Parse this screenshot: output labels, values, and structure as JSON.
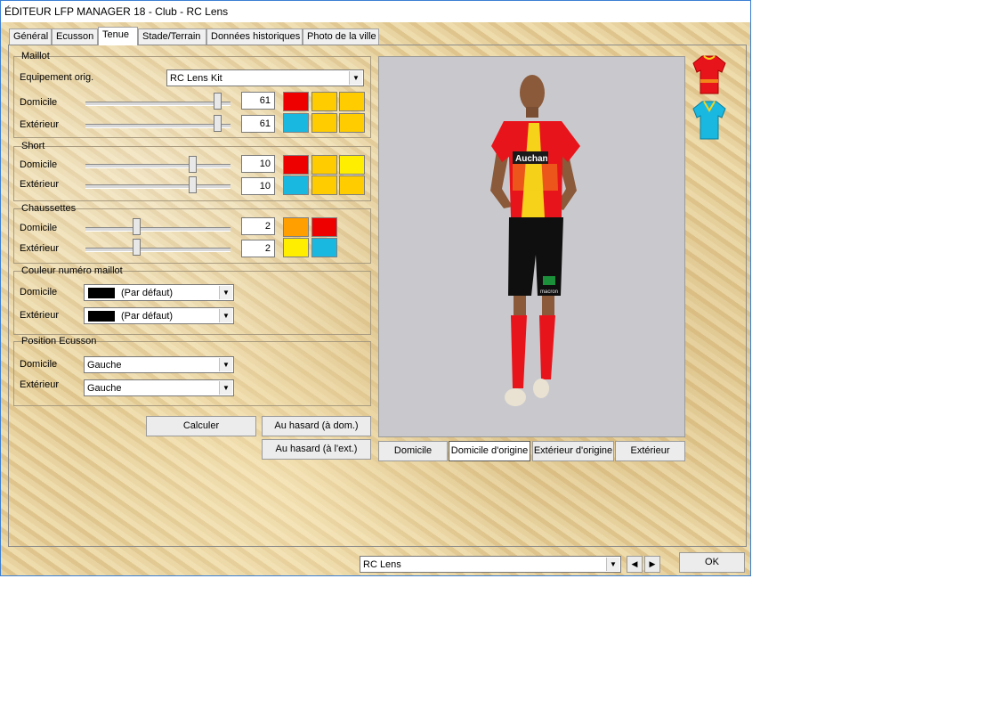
{
  "window": {
    "title": "ÉDITEUR LFP MANAGER 18 - Club - RC Lens"
  },
  "tabs": [
    {
      "label": "Général"
    },
    {
      "label": "Ecusson"
    },
    {
      "label": "Tenue"
    },
    {
      "label": "Stade/Terrain"
    },
    {
      "label": "Données historiques"
    },
    {
      "label": "Photo de la ville"
    }
  ],
  "maillot": {
    "title": "Maillot",
    "orig_label": "Equipement orig.",
    "orig_value": "RC Lens Kit",
    "home_label": "Domicile",
    "home_value": "61",
    "away_label": "Extérieur",
    "away_value": "61",
    "home_colors": [
      "#ee0000",
      "#ffcc00",
      "#ffcc00"
    ],
    "away_colors": [
      "#19b8e0",
      "#ffcc00",
      "#ffcc00"
    ]
  },
  "short": {
    "title": "Short",
    "home_label": "Domicile",
    "home_value": "10",
    "away_label": "Extérieur",
    "away_value": "10",
    "home_colors": [
      "#ee0000",
      "#ffcc00",
      "#ffee00"
    ],
    "away_colors": [
      "#19b8e0",
      "#ffcc00",
      "#ffcc00"
    ]
  },
  "chaussettes": {
    "title": "Chaussettes",
    "home_label": "Domicile",
    "home_value": "2",
    "away_label": "Extérieur",
    "away_value": "2",
    "home_colors": [
      "#ffa000",
      "#ee0000"
    ],
    "away_colors": [
      "#ffee00",
      "#19b8e0"
    ]
  },
  "numero": {
    "title": "Couleur numéro maillot",
    "home_label": "Domicile",
    "home_value": "(Par défaut)",
    "away_label": "Extérieur",
    "away_value": "(Par défaut)"
  },
  "ecusson_pos": {
    "title": "Position Ecusson",
    "home_label": "Domicile",
    "home_value": "Gauche",
    "away_label": "Extérieur",
    "away_value": "Gauche"
  },
  "buttons": {
    "calculer": "Calculer",
    "hasard_dom": "Au hasard (à dom.)",
    "hasard_ext": "Au hasard (à l'ext.)"
  },
  "preview_buttons": {
    "domicile": "Domicile",
    "domicile_origine": "Domicile d'origine",
    "exterieur_origine": "Extérieur d'origine",
    "exterieur": "Extérieur"
  },
  "kit_text": {
    "sponsor": "Auchan",
    "shorts_sponsor": "macron"
  },
  "bottom": {
    "club_select": "RC Lens",
    "ok": "OK"
  },
  "icons": {
    "home_shirt": "home-shirt-icon",
    "away_shirt": "away-shirt-icon"
  }
}
